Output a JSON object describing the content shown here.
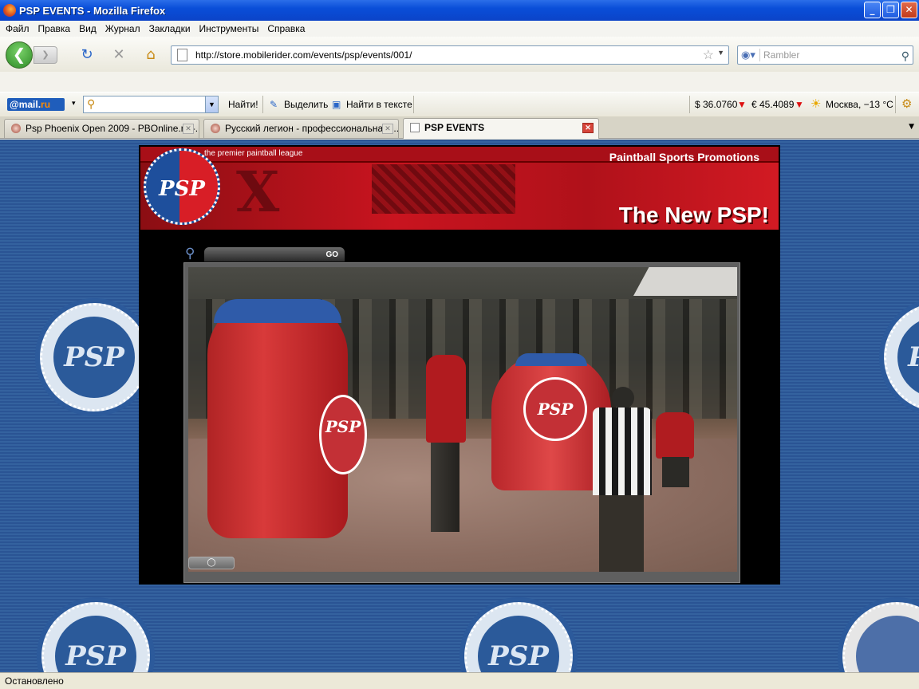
{
  "window": {
    "title": "PSP EVENTS - Mozilla Firefox",
    "min_label": "_",
    "max_label": "❐",
    "close_label": "✕"
  },
  "menu": [
    "Файл",
    "Правка",
    "Вид",
    "Журнал",
    "Закладки",
    "Инструменты",
    "Справка"
  ],
  "nav": {
    "back_glyph": "❮",
    "forward_glyph": "❯",
    "reload_glyph": "↻",
    "stop_glyph": "✕",
    "home_glyph": "⌂",
    "url": "http://store.mobilerider.com/events/psp/events/001/",
    "search_placeholder": "Rambler"
  },
  "mailbar": {
    "logo_prefix": "@mail.",
    "logo_suffix": "ru",
    "find_label": "Найти!",
    "highlight_label": "Выделить",
    "find_in_text_label": "Найти в тексте",
    "usd": "$ 36.0760",
    "eur": "€ 45.4089",
    "weather": "Москва, −13 °C"
  },
  "tabs": [
    {
      "label": "Psp Phoenix Open 2009 - PBOnline.ru -...",
      "active": false
    },
    {
      "label": "Русский легион - профессиональная ...",
      "active": false
    },
    {
      "label": "PSP EVENTS",
      "active": true
    }
  ],
  "page": {
    "tagline": "the premier paintball league",
    "promotions": "Paintball Sports Promotions",
    "headline": "The New PSP!",
    "seal_text": "PSP",
    "search_go": "GO",
    "video_control": "◯"
  },
  "status": "Остановлено",
  "colors": {
    "titlebar": "#0a4ed8",
    "page_bg": "#2a5494",
    "banner_red": "#c9141f"
  }
}
